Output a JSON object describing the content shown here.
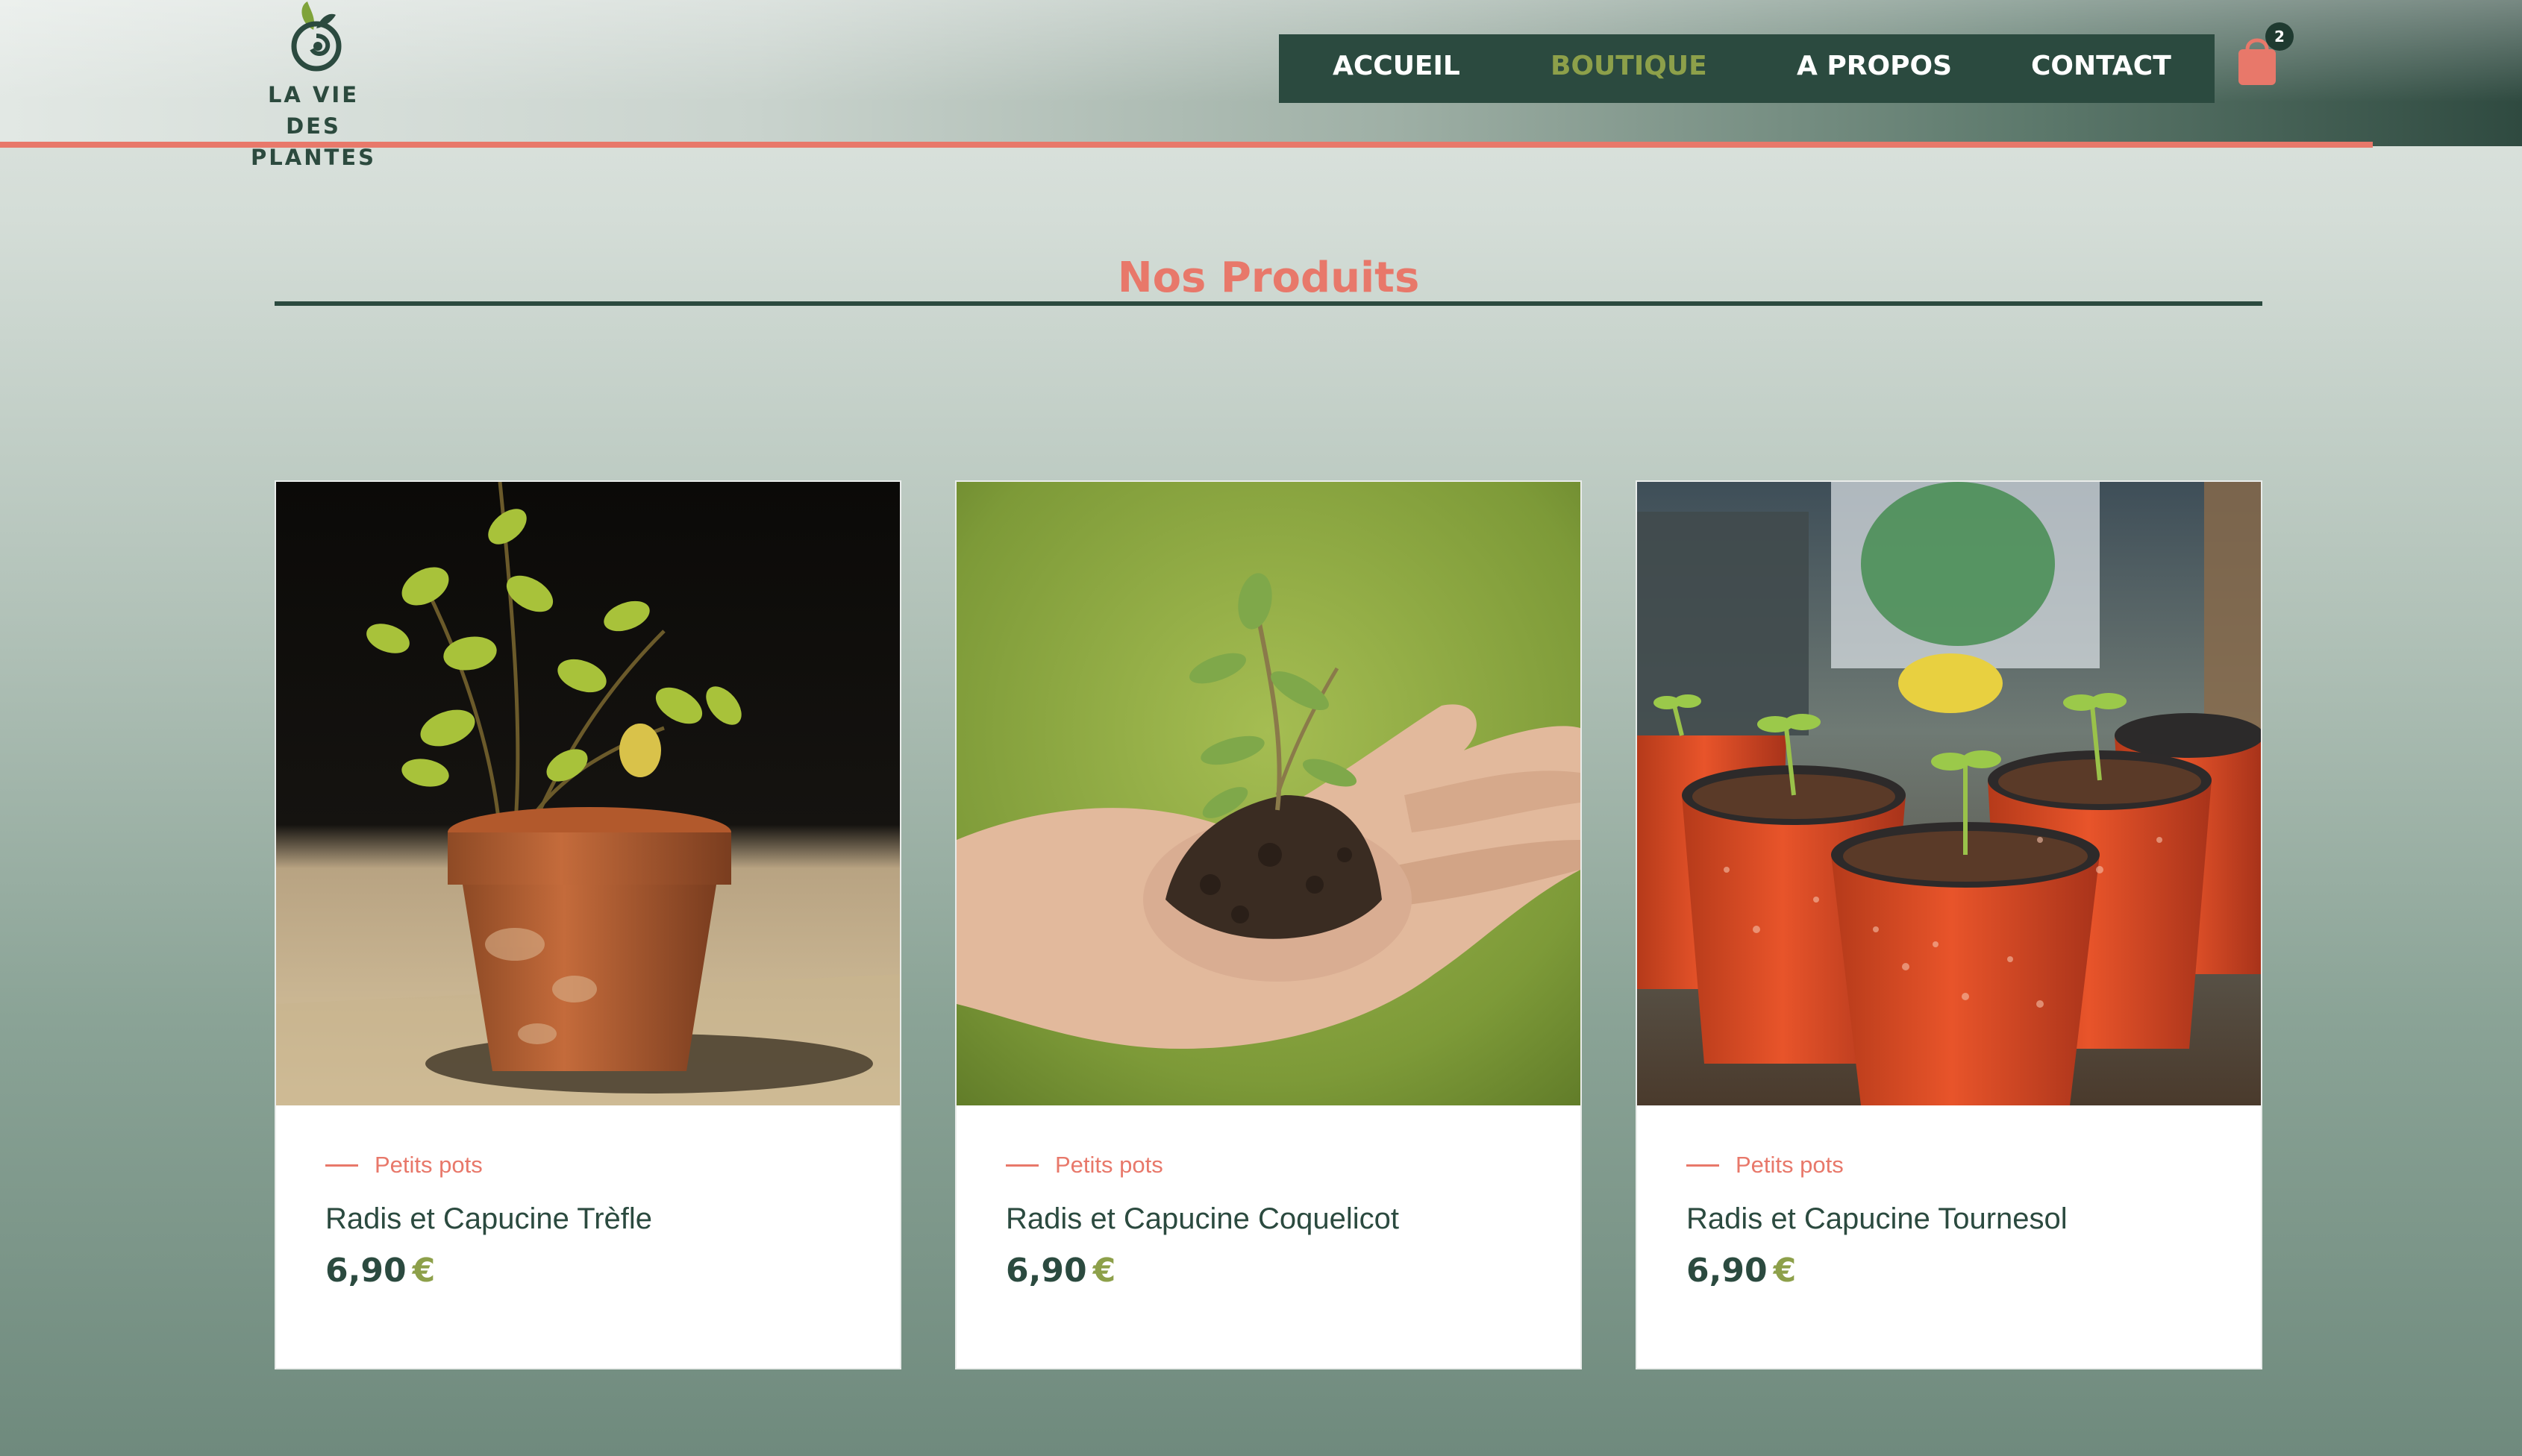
{
  "brand": {
    "name_line1": "LA VIE DES",
    "name_line2": "PLANTES",
    "logo_icon": "seedling-swirl-icon"
  },
  "nav": {
    "items": [
      {
        "label": "ACCUEIL",
        "active": false
      },
      {
        "label": "BOUTIQUE",
        "active": true
      },
      {
        "label": "A PROPOS",
        "active": false
      },
      {
        "label": "CONTACT",
        "active": false
      }
    ],
    "cart_icon": "shopping-bag-icon",
    "cart_count": "2"
  },
  "section": {
    "title": "Nos Produits"
  },
  "products": [
    {
      "category": "Petits pots",
      "name": "Radis et Capucine Trèfle",
      "price": "6,90",
      "currency": "€",
      "image_icon": "potted-plant-photo"
    },
    {
      "category": "Petits pots",
      "name": "Radis et Capucine Coquelicot",
      "price": "6,90",
      "currency": "€",
      "image_icon": "seedling-in-hand-photo"
    },
    {
      "category": "Petits pots",
      "name": "Radis et Capucine Tournesol",
      "price": "6,90",
      "currency": "€",
      "image_icon": "seedling-pots-photo"
    }
  ],
  "colors": {
    "accent": "#e8786a",
    "dark_green": "#2b4a3f",
    "olive": "#8da04a"
  }
}
